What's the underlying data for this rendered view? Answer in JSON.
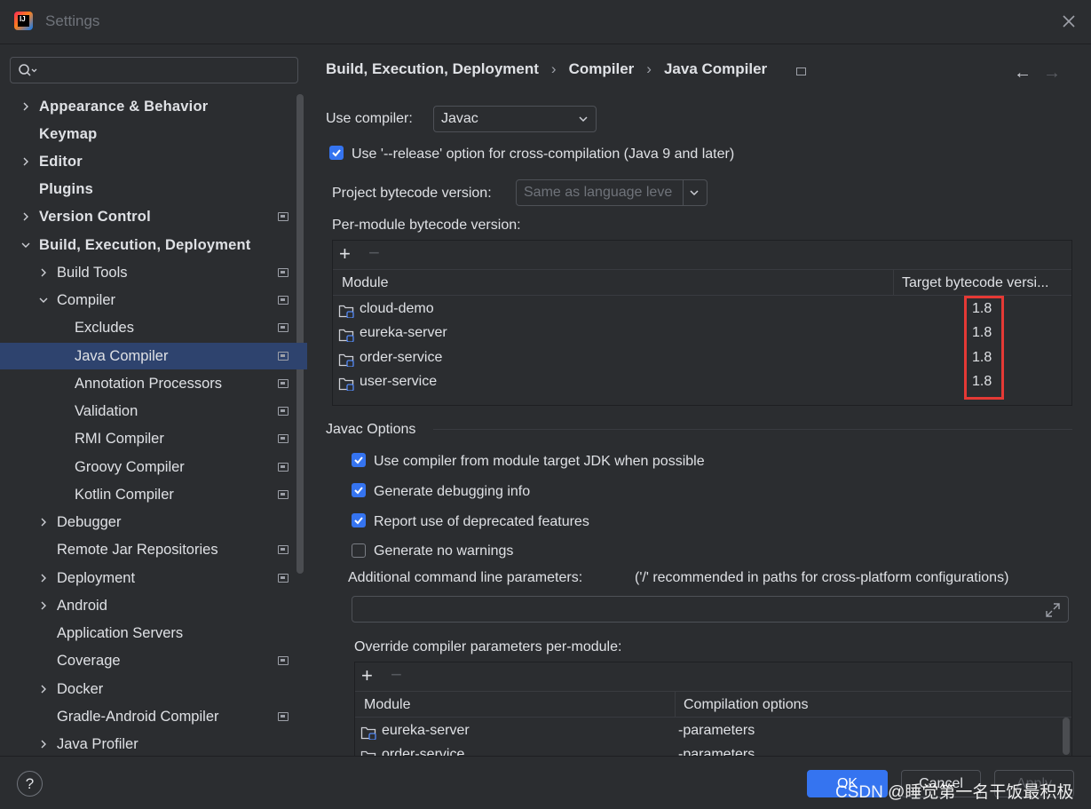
{
  "window": {
    "title": "Settings"
  },
  "search": {
    "placeholder": ""
  },
  "sidebar": {
    "items": [
      {
        "label": "Appearance & Behavior",
        "name": "appearance-behavior"
      },
      {
        "label": "Keymap",
        "name": "keymap"
      },
      {
        "label": "Editor",
        "name": "editor"
      },
      {
        "label": "Plugins",
        "name": "plugins"
      },
      {
        "label": "Version Control",
        "name": "version-control"
      },
      {
        "label": "Build, Execution, Deployment",
        "name": "build-execution-deployment"
      },
      {
        "label": "Build Tools",
        "name": "build-tools"
      },
      {
        "label": "Compiler",
        "name": "compiler"
      },
      {
        "label": "Excludes",
        "name": "excludes"
      },
      {
        "label": "Java Compiler",
        "name": "java-compiler"
      },
      {
        "label": "Annotation Processors",
        "name": "annotation-processors"
      },
      {
        "label": "Validation",
        "name": "validation"
      },
      {
        "label": "RMI Compiler",
        "name": "rmi-compiler"
      },
      {
        "label": "Groovy Compiler",
        "name": "groovy-compiler"
      },
      {
        "label": "Kotlin Compiler",
        "name": "kotlin-compiler"
      },
      {
        "label": "Debugger",
        "name": "debugger"
      },
      {
        "label": "Remote Jar Repositories",
        "name": "remote-jar-repositories"
      },
      {
        "label": "Deployment",
        "name": "deployment"
      },
      {
        "label": "Android",
        "name": "android"
      },
      {
        "label": "Application Servers",
        "name": "application-servers"
      },
      {
        "label": "Coverage",
        "name": "coverage"
      },
      {
        "label": "Docker",
        "name": "docker"
      },
      {
        "label": "Gradle-Android Compiler",
        "name": "gradle-android-compiler"
      },
      {
        "label": "Java Profiler",
        "name": "java-profiler"
      }
    ]
  },
  "breadcrumb": {
    "part1": "Build, Execution, Deployment",
    "sep1": "›",
    "part2": "Compiler",
    "sep2": "›",
    "part3": "Java Compiler"
  },
  "nav": {
    "back": "←",
    "forward": "→"
  },
  "compiler": {
    "use_compiler_label": "Use compiler:",
    "use_compiler_value": "Javac",
    "release_option_label": "Use '--release' option for cross-compilation (Java 9 and later)",
    "project_bytecode_label": "Project bytecode version:",
    "project_bytecode_value": "Same as language leve",
    "per_module_label": "Per-module bytecode version:",
    "module_header": "Module",
    "target_header": "Target bytecode versi...",
    "modules": [
      {
        "name": "cloud-demo",
        "target": "1.8"
      },
      {
        "name": "eureka-server",
        "target": "1.8"
      },
      {
        "name": "order-service",
        "target": "1.8"
      },
      {
        "name": "user-service",
        "target": "1.8"
      }
    ]
  },
  "javac": {
    "section_title": "Javac Options",
    "opt1": "Use compiler from module target JDK when possible",
    "opt2": "Generate debugging info",
    "opt3": "Report use of deprecated features",
    "opt4": "Generate no warnings",
    "additional_label": "Additional command line parameters:",
    "additional_hint": "('/' recommended in paths for cross-platform configurations)",
    "additional_value": "",
    "override_label": "Override compiler parameters per-module:",
    "override_module_header": "Module",
    "override_options_header": "Compilation options",
    "overrides": [
      {
        "module": "eureka-server",
        "options": "-parameters"
      },
      {
        "module": "order-service",
        "options": "-parameters"
      }
    ]
  },
  "footer": {
    "help": "?",
    "ok": "OK",
    "cancel": "Cancel",
    "apply": "Apply"
  },
  "watermark": "CSDN @睡觉第一名干饭最积极",
  "colors": {
    "accent": "#3574f0",
    "selection": "#2e436e",
    "highlight_box": "#e53935"
  }
}
